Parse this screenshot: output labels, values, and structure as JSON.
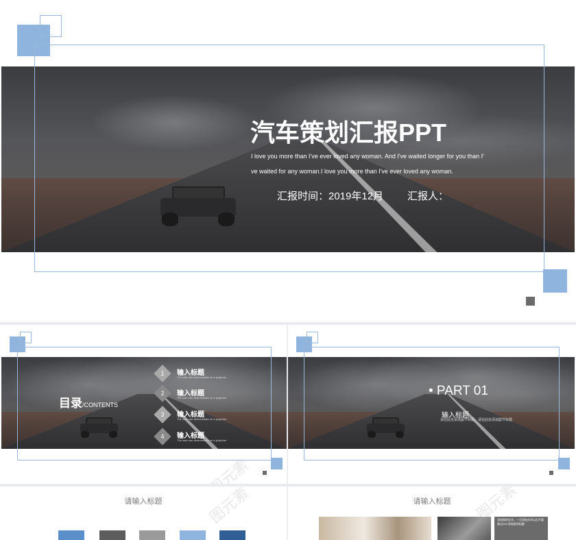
{
  "cover": {
    "title": "汽车策划汇报PPT",
    "subtitle_line1": "I love you more than I've ever loved any woman. And I've waited longer for you than I'",
    "subtitle_line2": "ve waited for any woman.I love you more than I've ever loved any woman.",
    "report_time": "汇报时间：2019年12月",
    "reporter": "汇报人："
  },
  "toc": {
    "title": "目录",
    "title_en": "/CONTENTS",
    "items": [
      {
        "number": "1",
        "heading": "输入标题",
        "desc": "The user can demonstrate on a projector"
      },
      {
        "number": "2",
        "heading": "输入标题",
        "desc": "The user can demonstrate on a projector"
      },
      {
        "number": "3",
        "heading": "输入标题",
        "desc": "The user can demonstrate on a projector"
      },
      {
        "number": "4",
        "heading": "输入标题",
        "desc": "The user can demonstrate on a projector"
      }
    ]
  },
  "part": {
    "label": "• PART 01",
    "heading": "输入标题",
    "desc": "请在此处添加副节标题，请在此处添加副节标题"
  },
  "slide_bottom_left": {
    "title": "请输入标题"
  },
  "slide_bottom_right": {
    "title": "请输入标题",
    "card_text": "添加您的文字，一旦添加文字以后不要超过200.添加您的标题"
  },
  "watermark": "图元素",
  "colors": {
    "accent_blue": "#8fb5de",
    "outline_blue": "#9bb8d8",
    "gray_square": "#6b6b6b",
    "bottom_buttons": [
      "#5b8fc9",
      "#5d5d5d",
      "#9a9a9a",
      "#8fb5de",
      "#2f5f94"
    ]
  }
}
